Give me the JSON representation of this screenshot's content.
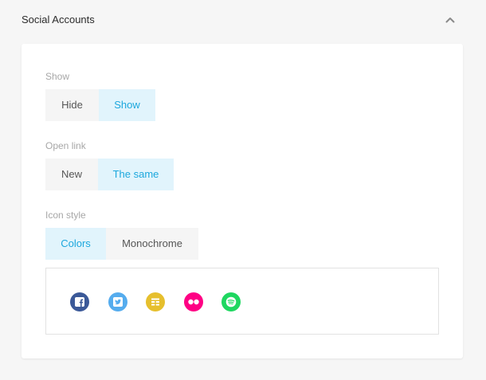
{
  "panel": {
    "title": "Social Accounts",
    "collapse_icon": "chevron-up-icon"
  },
  "show": {
    "label": "Show",
    "options": [
      {
        "label": "Hide"
      },
      {
        "label": "Show"
      }
    ],
    "selected": "Show"
  },
  "open_link": {
    "label": "Open link",
    "options": [
      {
        "label": "New"
      },
      {
        "label": "The same"
      }
    ],
    "selected": "The same"
  },
  "icon_style": {
    "label": "Icon style",
    "options": [
      {
        "label": "Colors"
      },
      {
        "label": "Monochrome"
      }
    ],
    "selected": "Colors"
  },
  "social_icons": [
    {
      "name": "facebook-icon",
      "color": "#3b5998"
    },
    {
      "name": "twitter-icon",
      "color": "#55acee"
    },
    {
      "name": "meetup-icon",
      "color": "#e6bf2d"
    },
    {
      "name": "flickr-icon",
      "color": "#ff0084"
    },
    {
      "name": "spotify-icon",
      "color": "#1ed760"
    }
  ],
  "colors": {
    "accent": "#1ca7dd",
    "active_bg": "#e1f4fc"
  }
}
